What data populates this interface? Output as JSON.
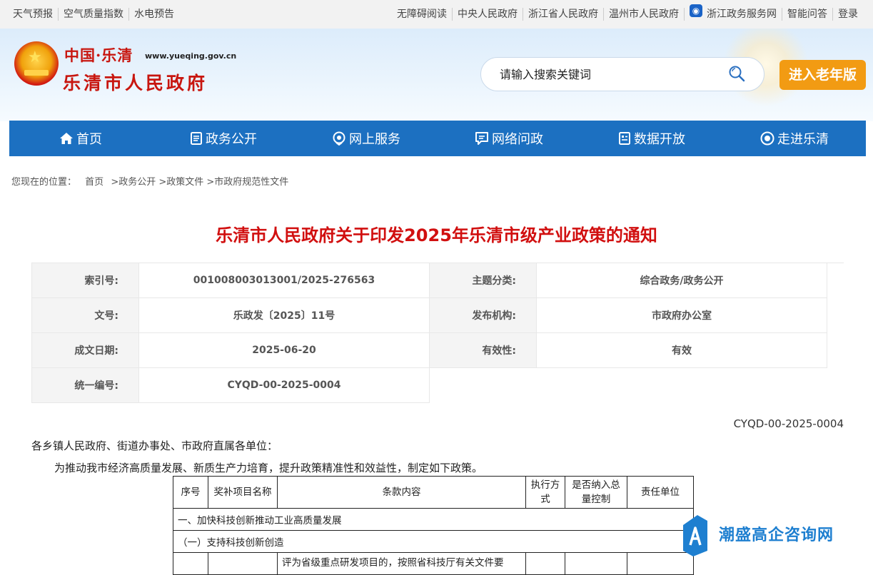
{
  "topbar": {
    "left": [
      "天气预报",
      "空气质量指数",
      "水电预告"
    ],
    "right": [
      "无障碍阅读",
      "中央人民政府",
      "浙江省人民政府",
      "温州市人民政府",
      "浙江政务服务网",
      "智能问答",
      "登录"
    ]
  },
  "header": {
    "logo_top": "中国·乐清",
    "logo_url": "www.yueqing.gov.cn",
    "logo_main": "乐清市人民政府",
    "search_placeholder": "请输入搜索关键词",
    "old_version": "进入老年版"
  },
  "nav": [
    "首页",
    "政务公开",
    "网上服务",
    "网络问政",
    "数据开放",
    "走进乐清"
  ],
  "breadcrumb": {
    "prefix": "您现在的位置：",
    "items": [
      "首页",
      ">政务公开",
      ">政策文件",
      ">市政府规范性文件"
    ]
  },
  "title": "乐清市人民政府关于印发2025年乐清市级产业政策的通知",
  "meta": {
    "index_label": "索引号:",
    "index_value": "001008003013001/2025-276563",
    "topic_label": "主题分类:",
    "topic_value": "综合政务/政务公开",
    "docno_label": "文号:",
    "docno_value": "乐政发〔2025〕11号",
    "org_label": "发布机构:",
    "org_value": "市政府办公室",
    "date_label": "成文日期:",
    "date_value": "2025-06-20",
    "valid_label": "有效性:",
    "valid_value": "有效",
    "code_label": "统一编号:",
    "code_value": "CYQD-00-2025-0004"
  },
  "body": {
    "docno": "CYQD-00-2025-0004",
    "greeting": "各乡镇人民政府、街道办事处、市政府直属各单位：",
    "intro": "为推动我市经济高质量发展、新质生产力培育，提升政策精准性和效益性，制定如下政策。"
  },
  "policy_table": {
    "headers": [
      "序号",
      "奖补项目名称",
      "条款内容",
      "执行方式",
      "是否纳入总量控制",
      "责任单位"
    ],
    "section1": "一、加快科技创新推动工业高质量发展",
    "subsection1": "（一）支持科技创新创造",
    "row1_content": "评为省级重点研发项目的，按照省科技厅有关文件要"
  },
  "watermark": "潮盛高企咨询网"
}
